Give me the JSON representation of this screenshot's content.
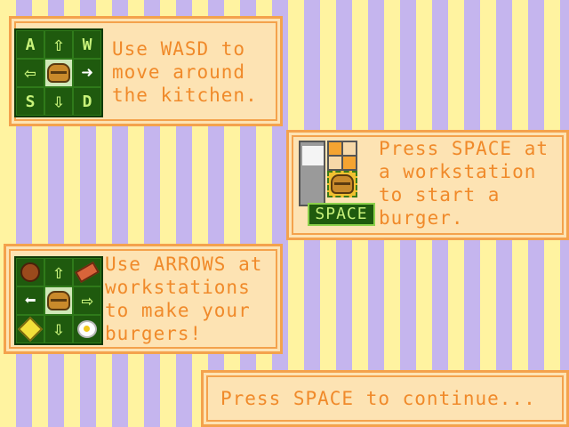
{
  "panels": {
    "move": {
      "text": "Use WASD to\nmove around\nthe kitchen.",
      "keys": {
        "up_left": "A",
        "up_right": "W",
        "down_left": "S",
        "down_right": "D"
      },
      "icons": {
        "up": "arrow-up-icon",
        "left": "arrow-left-icon",
        "right": "arrow-right-icon",
        "down": "arrow-down-icon",
        "center": "burger-icon"
      }
    },
    "start": {
      "text": "Press SPACE at\na workstation\nto start a\nburger.",
      "key_label": "SPACE",
      "icons": {
        "station": "workstation-icon",
        "burger": "burger-icon"
      }
    },
    "make": {
      "text": "Use ARROWS at\nworkstations\nto make your\nburgers!",
      "icons": {
        "up_left": "meat-patty-icon",
        "up_right": "bacon-icon",
        "down_left": "cheese-icon",
        "down_right": "egg-icon",
        "center": "burger-icon"
      }
    },
    "continue": {
      "text": "Press SPACE to continue..."
    }
  },
  "colors": {
    "panel_bg": "#fde3b3",
    "panel_border": "#f4a24c",
    "text": "#f08a2a",
    "stripe_yellow": "#fff3a0",
    "stripe_purple": "#c5b5ee",
    "keypad_bg": "#1f5a0e",
    "keypad_fg": "#c8f27a"
  }
}
